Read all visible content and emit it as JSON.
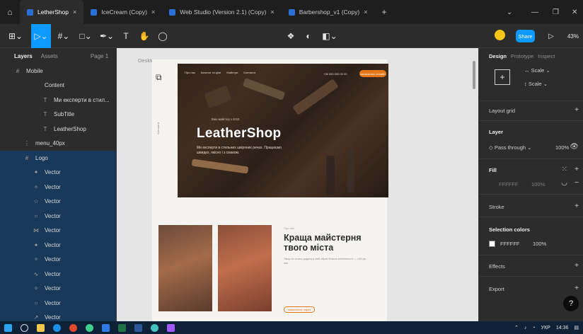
{
  "tabs": [
    {
      "label": "LetherShop",
      "active": true
    },
    {
      "label": "IceCream (Copy)",
      "active": false
    },
    {
      "label": "Web Studio (Version 2.1) (Copy)",
      "active": false
    },
    {
      "label": "Barbershop_v1 (Copy)",
      "active": false
    }
  ],
  "toolbar": {
    "share_label": "Share",
    "zoom": "43%"
  },
  "layers_panel": {
    "tab_layers": "Layers",
    "tab_assets": "Assets",
    "page": "Page 1",
    "rows": [
      {
        "icon": "#",
        "label": "Mobile",
        "indent": 0
      },
      {
        "icon": "",
        "label": "Content",
        "indent": 2
      },
      {
        "icon": "T",
        "label": "Ми експерти в стил...",
        "indent": 3
      },
      {
        "icon": "T",
        "label": "SubTitle",
        "indent": 3
      },
      {
        "icon": "T",
        "label": "LeatherShop",
        "indent": 3
      },
      {
        "icon": "⋮",
        "label": "menu_40px",
        "indent": 1
      },
      {
        "icon": "#",
        "label": "Logo",
        "indent": 1
      },
      {
        "icon": "✦",
        "label": "Vector",
        "indent": 2
      },
      {
        "icon": "✧",
        "label": "Vector",
        "indent": 2
      },
      {
        "icon": "☆",
        "label": "Vector",
        "indent": 2
      },
      {
        "icon": "○",
        "label": "Vector",
        "indent": 2
      },
      {
        "icon": "⋈",
        "label": "Vector",
        "indent": 2
      },
      {
        "icon": "✦",
        "label": "Vector",
        "indent": 2
      },
      {
        "icon": "✧",
        "label": "Vector",
        "indent": 2
      },
      {
        "icon": "∿",
        "label": "Vector",
        "indent": 2
      },
      {
        "icon": "✧",
        "label": "Vector",
        "indent": 2
      },
      {
        "icon": "○",
        "label": "Vector",
        "indent": 2
      },
      {
        "icon": "↗",
        "label": "Vector",
        "indent": 2
      }
    ]
  },
  "canvas": {
    "frame_label": "Desktop",
    "nav": [
      "Про нас",
      "Каталог та ціни",
      "Майстри",
      "Контакти"
    ],
    "phone": "+38 000 000 00 00",
    "cta": "записатись онлайн",
    "overline": "Ваш майстер з 2010",
    "hero_title": "LeatherShop",
    "hero_sub": "Ми експерти в стильних шкіряних речах. Працюємо швидко, якісно і з смаком.",
    "side_text": "Контакти",
    "section_overline": "Про нас",
    "section_title": "Краща майстерня твого міста",
    "section_body": "Якщо ти хочеш додати в свій образ більше впевненості — тобі до нас.",
    "section_btn": "записатись зараз"
  },
  "right_panel": {
    "tab_design": "Design",
    "tab_prototype": "Prototype",
    "tab_inspect": "Inspect",
    "scale1": "Scale",
    "scale2": "Scale",
    "layout_grid": "Layout grid",
    "layer": "Layer",
    "pass_through": "Pass through",
    "opacity": "100%",
    "fill": "Fill",
    "fill_hex": "FFFFFF",
    "fill_opacity": "100%",
    "stroke": "Stroke",
    "selection_colors": "Selection colors",
    "sel_hex": "FFFFFF",
    "sel_opacity": "100%",
    "effects": "Effects",
    "export": "Export"
  },
  "taskbar": {
    "lang": "УКР",
    "time": "14:36"
  },
  "colors": {
    "accent": "#0d99ff",
    "orange": "#e67718"
  }
}
